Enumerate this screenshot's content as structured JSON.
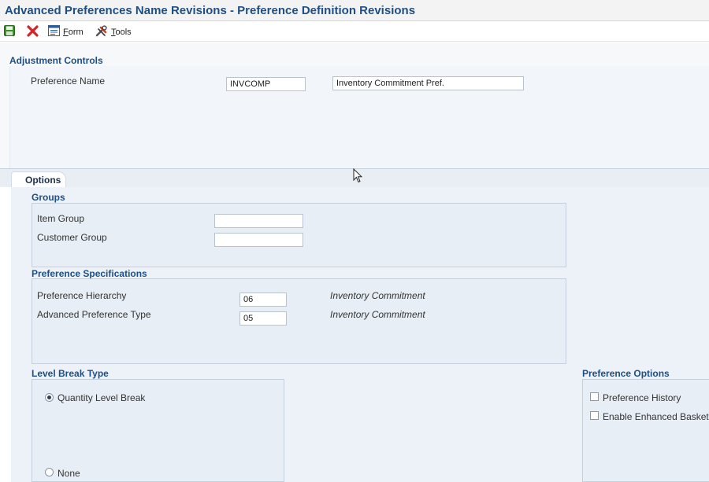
{
  "window": {
    "title": "Advanced Preferences Name Revisions - Preference Definition Revisions"
  },
  "toolbar": {
    "save_icon": "save-icon",
    "cancel_icon": "close-icon",
    "form_prefix": "F",
    "form_rest": "orm",
    "tools_prefix": "T",
    "tools_rest": "ools"
  },
  "adjustment_controls": {
    "header": "Adjustment Controls",
    "preference_name_label": "Preference Name",
    "preference_name_value": "INVCOMP",
    "preference_description_value": "Inventory Commitment Pref."
  },
  "tabs": [
    {
      "label": "Options",
      "active": true
    }
  ],
  "groups": {
    "header": "Groups",
    "item_group_label": "Item Group",
    "item_group_value": "",
    "customer_group_label": "Customer Group",
    "customer_group_value": ""
  },
  "preference_specifications": {
    "header": "Preference Specifications",
    "hierarchy_label": "Preference Hierarchy",
    "hierarchy_value": "06",
    "hierarchy_desc": "Inventory Commitment",
    "type_label": "Advanced Preference Type",
    "type_value": "05",
    "type_desc": "Inventory Commitment"
  },
  "level_break_type": {
    "header": "Level Break Type",
    "options": [
      {
        "label": "Quantity Level Break",
        "selected": true
      },
      {
        "label": "None",
        "selected": false
      }
    ]
  },
  "preference_options": {
    "header": "Preference Options",
    "items": [
      {
        "label": "Preference History",
        "checked": false
      },
      {
        "label": "Enable Enhanced Basket",
        "checked": false
      }
    ]
  },
  "colors": {
    "title": "#1d4f84",
    "header": "#1d4f84",
    "panel": "#edf2f8",
    "group_box": "#e8eef5"
  }
}
